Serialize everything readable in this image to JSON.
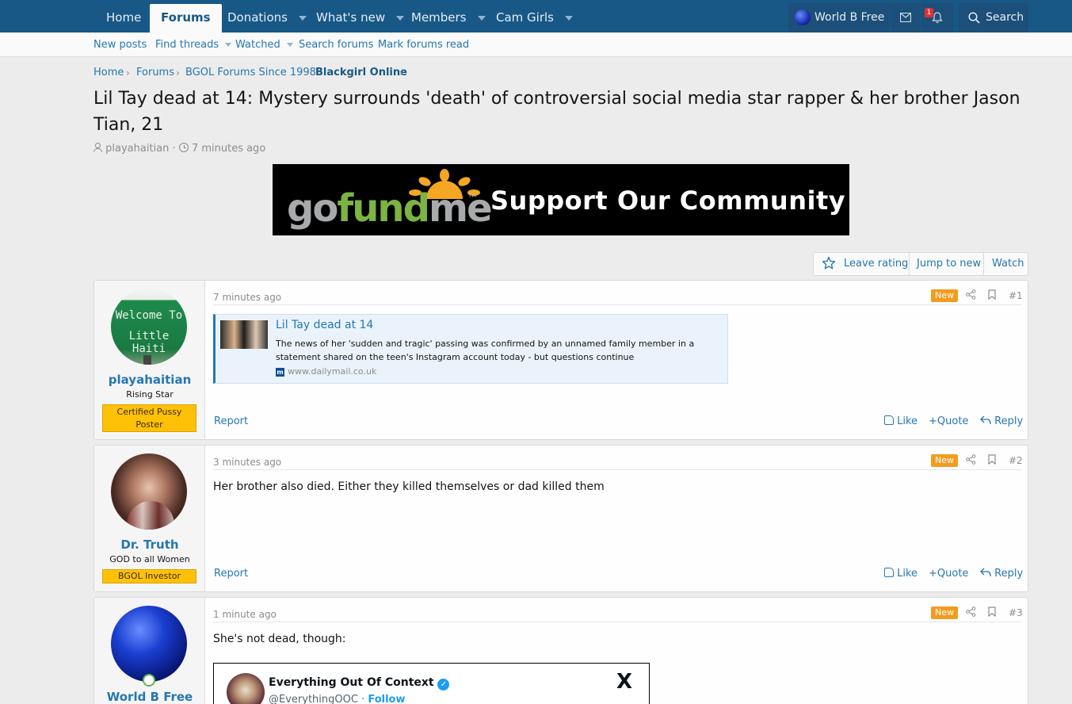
{
  "nav": {
    "tabs": [
      {
        "label": "Home"
      },
      {
        "label": "Forums"
      },
      {
        "label": "Donations"
      },
      {
        "label": "What's new"
      },
      {
        "label": "Members"
      },
      {
        "label": "Cam Girls"
      }
    ],
    "user": "World B Free",
    "alert_count": "1",
    "search_label": "Search"
  },
  "subnav": {
    "links": [
      "New posts",
      "Find threads",
      "Watched",
      "Search forums",
      "Mark forums read"
    ]
  },
  "breadcrumb": [
    "Home",
    "Forums",
    "BGOL Forums Since 1998",
    "Blackgirl Online"
  ],
  "thread": {
    "title": "Lil Tay dead at 14: Mystery surrounds 'death' of controversial social media star rapper & her brother Jason Tian, 21",
    "author": "playahaitian",
    "time": "7 minutes ago"
  },
  "banner": {
    "logo_go": "go",
    "logo_fund": "fund",
    "logo_me": "me",
    "tm": "TM",
    "tagline": "Support Our Community"
  },
  "actions": {
    "rating": "Leave rating",
    "jump": "Jump to new",
    "watch": "Watch"
  },
  "post_common": {
    "new": "New",
    "report": "Report",
    "like": "Like",
    "quote": "Quote",
    "reply": "Reply"
  },
  "posts": [
    {
      "username": "playahaitian",
      "user_title": "Rising Star",
      "badge": "Certified Pussy Poster",
      "avatar_text": [
        "Welcome To",
        "Little Haiti"
      ],
      "time": "7 minutes ago",
      "num": "#1",
      "link": {
        "title": "Lil Tay dead at 14",
        "desc": "The news of her 'sudden and tragic' passing was confirmed by an unnamed family member in a statement shared on the teen's Instagram account today - but questions continue",
        "domain": "www.dailymail.co.uk",
        "favicon": "m"
      }
    },
    {
      "username": "Dr. Truth",
      "user_title": "GOD to all Women",
      "badge": "BGOL Investor",
      "time": "3 minutes ago",
      "num": "#2",
      "body": "Her brother also died. Either they killed themselves or dad killed them"
    },
    {
      "username": "World B Free",
      "time": "1 minute ago",
      "num": "#3",
      "body": "She's not dead, though:",
      "embed": {
        "name": "Everything Out Of Context",
        "handle": "@EverythingOOC",
        "sep": " · ",
        "follow": "Follow",
        "x": "X"
      }
    }
  ],
  "colors": {
    "nav": "#185886",
    "link": "#2577b1",
    "new": "#f29c1f",
    "badge": "#ffc107"
  }
}
